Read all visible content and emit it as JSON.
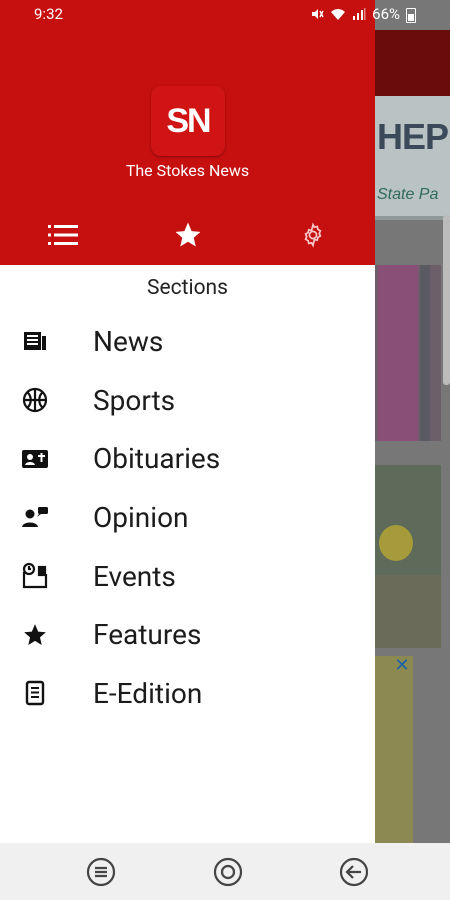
{
  "status_bar": {
    "time": "9:32",
    "battery": "66%"
  },
  "drawer": {
    "logo_text": "SN",
    "brand_name": "The Stokes News",
    "header_tabs": [
      {
        "icon": "list-icon"
      },
      {
        "icon": "star-icon"
      },
      {
        "icon": "gear-icon"
      }
    ],
    "sections_title": "Sections",
    "items": [
      {
        "label": "News",
        "icon": "newspaper-icon"
      },
      {
        "label": "Sports",
        "icon": "basketball-icon"
      },
      {
        "label": "Obituaries",
        "icon": "contact-card-icon"
      },
      {
        "label": "Opinion",
        "icon": "people-chat-icon"
      },
      {
        "label": "Events",
        "icon": "event-clock-icon"
      },
      {
        "label": "Features",
        "icon": "star-icon"
      },
      {
        "label": "E-Edition",
        "icon": "document-icon"
      }
    ]
  },
  "background": {
    "banner_text_1": "HEPE",
    "banner_text_2": "State Pa"
  },
  "colors": {
    "brand_red": "#c60f0f",
    "nav_bg": "#f0f0f0"
  }
}
